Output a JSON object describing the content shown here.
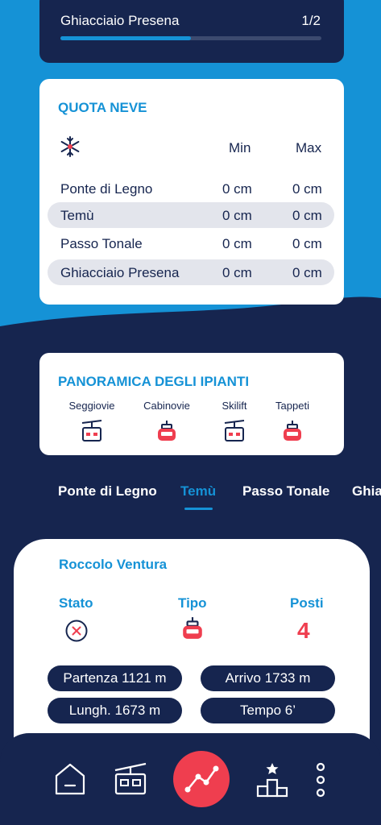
{
  "top_card": {
    "title": "Ghiacciaio Presena",
    "page": "1/2",
    "progress": 0.5
  },
  "snow": {
    "title": "QUOTA NEVE",
    "col_min": "Min",
    "col_max": "Max",
    "rows": [
      {
        "name": "Ponte di Legno",
        "min": "0 cm",
        "max": "0 cm"
      },
      {
        "name": "Temù",
        "min": "0 cm",
        "max": "0 cm"
      },
      {
        "name": "Passo Tonale",
        "min": "0 cm",
        "max": "0 cm"
      },
      {
        "name": "Ghiacciaio Presena",
        "min": "0 cm",
        "max": "0 cm"
      }
    ]
  },
  "panoramica": {
    "title": "PANORAMICA DEGLI IPIANTI",
    "items": [
      {
        "label": "Seggiovie",
        "icon": "chairlift-icon"
      },
      {
        "label": "Cabinovie",
        "icon": "gondola-icon"
      },
      {
        "label": "Skilift",
        "icon": "skilift-icon"
      },
      {
        "label": "Tappeti",
        "icon": "gondola-icon"
      }
    ]
  },
  "tabs": [
    "Ponte di Legno",
    "Temù",
    "Passo Tonale",
    "Ghia"
  ],
  "active_tab": "Temù",
  "lift": {
    "name": "Roccolo Ventura",
    "stato_label": "Stato",
    "tipo_label": "Tipo",
    "posti_label": "Posti",
    "posti": "4",
    "stato_icon": "closed-x-icon",
    "tipo_icon": "gondola-icon",
    "partenza": "Partenza 1121 m",
    "arrivo": "Arrivo 1733 m",
    "lunghezza": "Lungh. 1673 m",
    "tempo": "Tempo 6’"
  },
  "nav": [
    "home-icon",
    "lift-icon",
    "chart-icon",
    "podium-icon",
    "more-icon"
  ],
  "colors": {
    "navy": "#16254f",
    "blue": "#1592d6",
    "red": "#ef3e4f"
  }
}
